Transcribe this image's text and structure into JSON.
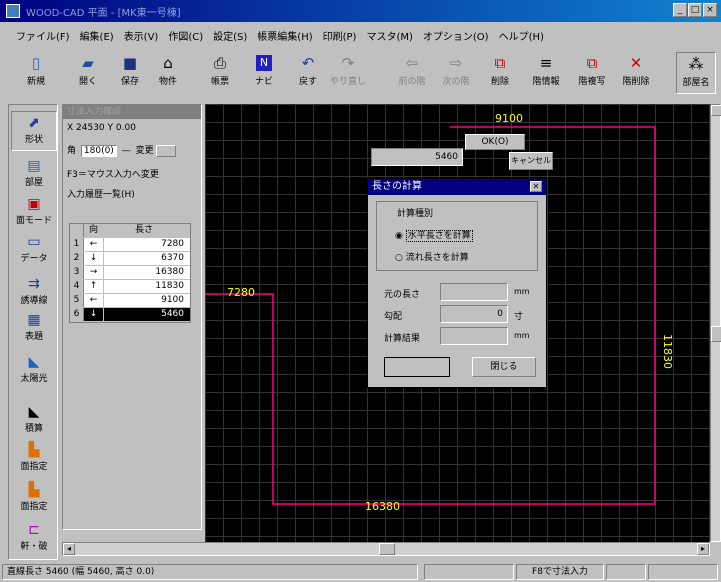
{
  "window": {
    "title": "WOOD-CAD 平面 - [MK東一号棟]"
  },
  "menu": [
    "ファイル(F)",
    "編集(E)",
    "表示(V)",
    "作図(C)",
    "設定(S)",
    "帳票編集(H)",
    "印刷(P)",
    "マスタ(M)",
    "オプション(O)",
    "ヘルプ(H)"
  ],
  "toolbar": [
    {
      "label": "新規"
    },
    {
      "label": "開く"
    },
    {
      "label": "保存"
    },
    {
      "label": "物件"
    },
    {
      "label": "帳票"
    },
    {
      "label": "ナビ"
    },
    {
      "label": "戻す"
    },
    {
      "label": "やり直し"
    },
    {
      "label": "前の階"
    },
    {
      "label": "次の階"
    },
    {
      "label": "削除"
    },
    {
      "label": "階情報"
    },
    {
      "label": "階複写"
    },
    {
      "label": "階削除"
    },
    {
      "label": "部屋名"
    }
  ],
  "left_tools": [
    {
      "label": "形状"
    },
    {
      "label": "部屋"
    },
    {
      "label": "面モード"
    },
    {
      "label": "データ"
    },
    {
      "label": "誘導線"
    },
    {
      "label": "表題"
    },
    {
      "label": "太陽光"
    },
    {
      "label": "積算"
    },
    {
      "label": "面指定"
    },
    {
      "label": "面指定"
    },
    {
      "label": "軒・破"
    }
  ],
  "input_panel": {
    "title": "寸法入力確認",
    "coord": "X 24530 Y 0.00",
    "angle_label": "角",
    "angle_value": "180(0)",
    "change_label": "変更",
    "hint": "F3＝マウス入力へ変更",
    "history_label": "入力履歴一覧(H)",
    "col_dir": "向",
    "col_len": "長さ",
    "rows": [
      {
        "no": "1",
        "dir": "←",
        "len": "7280"
      },
      {
        "no": "2",
        "dir": "↓",
        "len": "6370"
      },
      {
        "no": "3",
        "dir": "→",
        "len": "16380"
      },
      {
        "no": "4",
        "dir": "↑",
        "len": "11830"
      },
      {
        "no": "5",
        "dir": "←",
        "len": "9100"
      },
      {
        "no": "6",
        "dir": "↓",
        "len": "5460"
      }
    ]
  },
  "canvas": {
    "dim_top": "9100",
    "dim_left": "7280",
    "dim_right": "11830",
    "dim_bottom": "16380"
  },
  "okbox": {
    "value": "5460",
    "ok": "OK(O)",
    "cancel": "キャンセル"
  },
  "dialog": {
    "title": "長さの計算",
    "group": "計算種別",
    "opt1": "水平長さを計算",
    "opt2": "流れ長さを計算",
    "orig_label": "元の長さ",
    "orig_unit": "mm",
    "slope_label": "勾配",
    "slope_value": "0",
    "slope_unit": "寸",
    "result_label": "計算結果",
    "result_unit": "mm",
    "btn_close": "閉じる"
  },
  "status": {
    "left": "直線長さ 5460 (幅 5460, 高さ 0.0)",
    "mode": "F8で寸法入力"
  }
}
